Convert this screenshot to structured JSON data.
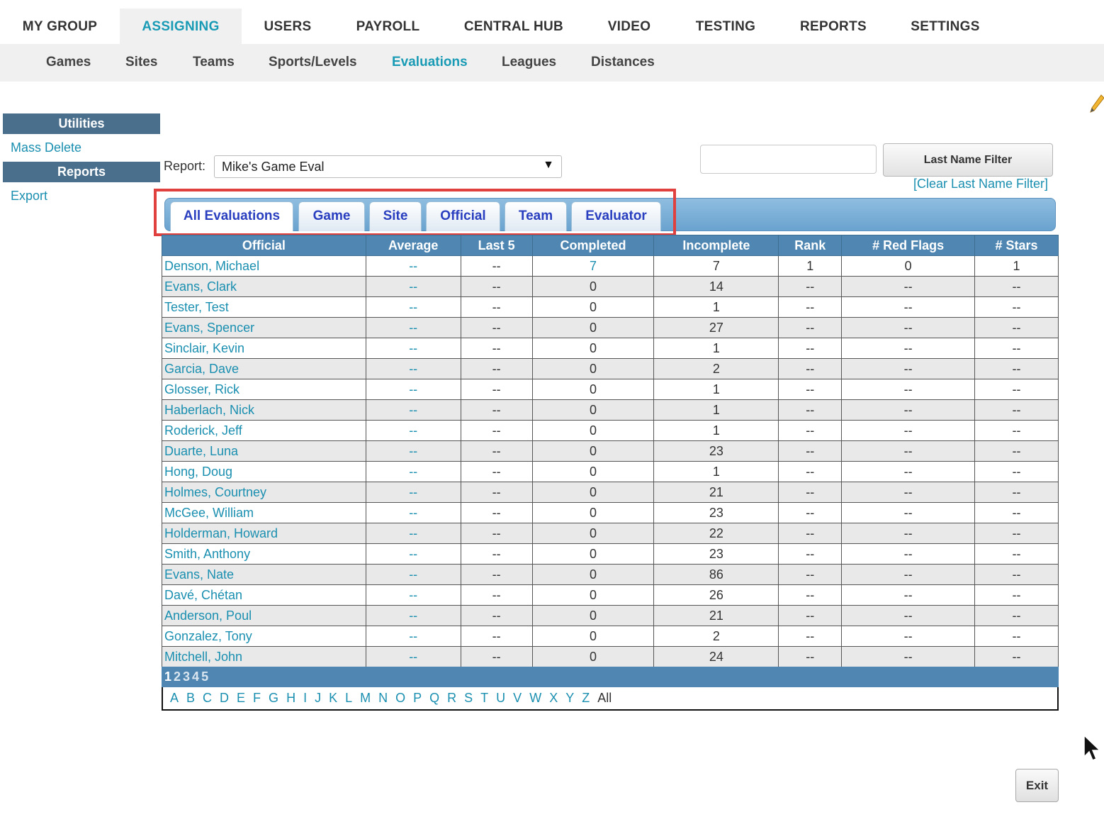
{
  "top_nav": [
    {
      "label": "MY GROUP",
      "active": false
    },
    {
      "label": "ASSIGNING",
      "active": true
    },
    {
      "label": "USERS",
      "active": false
    },
    {
      "label": "PAYROLL",
      "active": false
    },
    {
      "label": "CENTRAL HUB",
      "active": false
    },
    {
      "label": "VIDEO",
      "active": false
    },
    {
      "label": "TESTING",
      "active": false
    },
    {
      "label": "REPORTS",
      "active": false
    },
    {
      "label": "SETTINGS",
      "active": false
    }
  ],
  "sub_nav": [
    {
      "label": "Games",
      "active": false
    },
    {
      "label": "Sites",
      "active": false
    },
    {
      "label": "Teams",
      "active": false
    },
    {
      "label": "Sports/Levels",
      "active": false
    },
    {
      "label": "Evaluations",
      "active": true
    },
    {
      "label": "Leagues",
      "active": false
    },
    {
      "label": "Distances",
      "active": false
    }
  ],
  "sidebar": {
    "utilities_header": "Utilities",
    "mass_delete": "Mass Delete",
    "reports_header": "Reports",
    "export": "Export"
  },
  "report": {
    "label": "Report:",
    "selected": "Mike's Game Eval"
  },
  "filter": {
    "input_value": "",
    "button_label": "Last Name Filter",
    "clear_label": "[Clear Last Name Filter]"
  },
  "tabs": [
    {
      "label": "All Evaluations",
      "active": true
    },
    {
      "label": "Game",
      "active": false
    },
    {
      "label": "Site",
      "active": false
    },
    {
      "label": "Official",
      "active": false
    },
    {
      "label": "Team",
      "active": false
    },
    {
      "label": "Evaluator",
      "active": false
    }
  ],
  "table": {
    "columns": [
      "Official",
      "Average",
      "Last 5",
      "Completed",
      "Incomplete",
      "Rank",
      "# Red Flags",
      "# Stars"
    ],
    "rows": [
      [
        "Denson, Michael",
        "--",
        "--",
        "7",
        "7",
        "1",
        "0",
        "1"
      ],
      [
        "Evans, Clark",
        "--",
        "--",
        "0",
        "14",
        "--",
        "--",
        "--"
      ],
      [
        "Tester, Test",
        "--",
        "--",
        "0",
        "1",
        "--",
        "--",
        "--"
      ],
      [
        "Evans, Spencer",
        "--",
        "--",
        "0",
        "27",
        "--",
        "--",
        "--"
      ],
      [
        "Sinclair, Kevin",
        "--",
        "--",
        "0",
        "1",
        "--",
        "--",
        "--"
      ],
      [
        "Garcia, Dave",
        "--",
        "--",
        "0",
        "2",
        "--",
        "--",
        "--"
      ],
      [
        "Glosser, Rick",
        "--",
        "--",
        "0",
        "1",
        "--",
        "--",
        "--"
      ],
      [
        "Haberlach, Nick",
        "--",
        "--",
        "0",
        "1",
        "--",
        "--",
        "--"
      ],
      [
        "Roderick, Jeff",
        "--",
        "--",
        "0",
        "1",
        "--",
        "--",
        "--"
      ],
      [
        "Duarte, Luna",
        "--",
        "--",
        "0",
        "23",
        "--",
        "--",
        "--"
      ],
      [
        "Hong, Doug",
        "--",
        "--",
        "0",
        "1",
        "--",
        "--",
        "--"
      ],
      [
        "Holmes, Courtney",
        "--",
        "--",
        "0",
        "21",
        "--",
        "--",
        "--"
      ],
      [
        "McGee, William",
        "--",
        "--",
        "0",
        "23",
        "--",
        "--",
        "--"
      ],
      [
        "Holderman, Howard",
        "--",
        "--",
        "0",
        "22",
        "--",
        "--",
        "--"
      ],
      [
        "Smith, Anthony",
        "--",
        "--",
        "0",
        "23",
        "--",
        "--",
        "--"
      ],
      [
        "Evans, Nate",
        "--",
        "--",
        "0",
        "86",
        "--",
        "--",
        "--"
      ],
      [
        "Davé, Chétan",
        "--",
        "--",
        "0",
        "26",
        "--",
        "--",
        "--"
      ],
      [
        "Anderson, Poul",
        "--",
        "--",
        "0",
        "21",
        "--",
        "--",
        "--"
      ],
      [
        "Gonzalez, Tony",
        "--",
        "--",
        "0",
        "2",
        "--",
        "--",
        "--"
      ],
      [
        "Mitchell, John",
        "--",
        "--",
        "0",
        "24",
        "--",
        "--",
        "--"
      ]
    ]
  },
  "pages": [
    "1",
    "2",
    "3",
    "4",
    "5"
  ],
  "current_page": "1",
  "alphabet": [
    "A",
    "B",
    "C",
    "D",
    "E",
    "F",
    "G",
    "H",
    "I",
    "J",
    "K",
    "L",
    "M",
    "N",
    "O",
    "P",
    "Q",
    "R",
    "S",
    "T",
    "U",
    "V",
    "W",
    "X",
    "Y",
    "Z",
    "All"
  ],
  "exit_label": "Exit",
  "colors": {
    "accent": "#1a9bb5",
    "header_blue": "#4f87b2",
    "sidebar_header": "#4a6f8c",
    "highlight_red": "#e0413f",
    "tab_text": "#2a3fbf"
  },
  "icons": [
    "pencil-icon",
    "dropdown-arrow-icon",
    "mouse-cursor-icon"
  ]
}
